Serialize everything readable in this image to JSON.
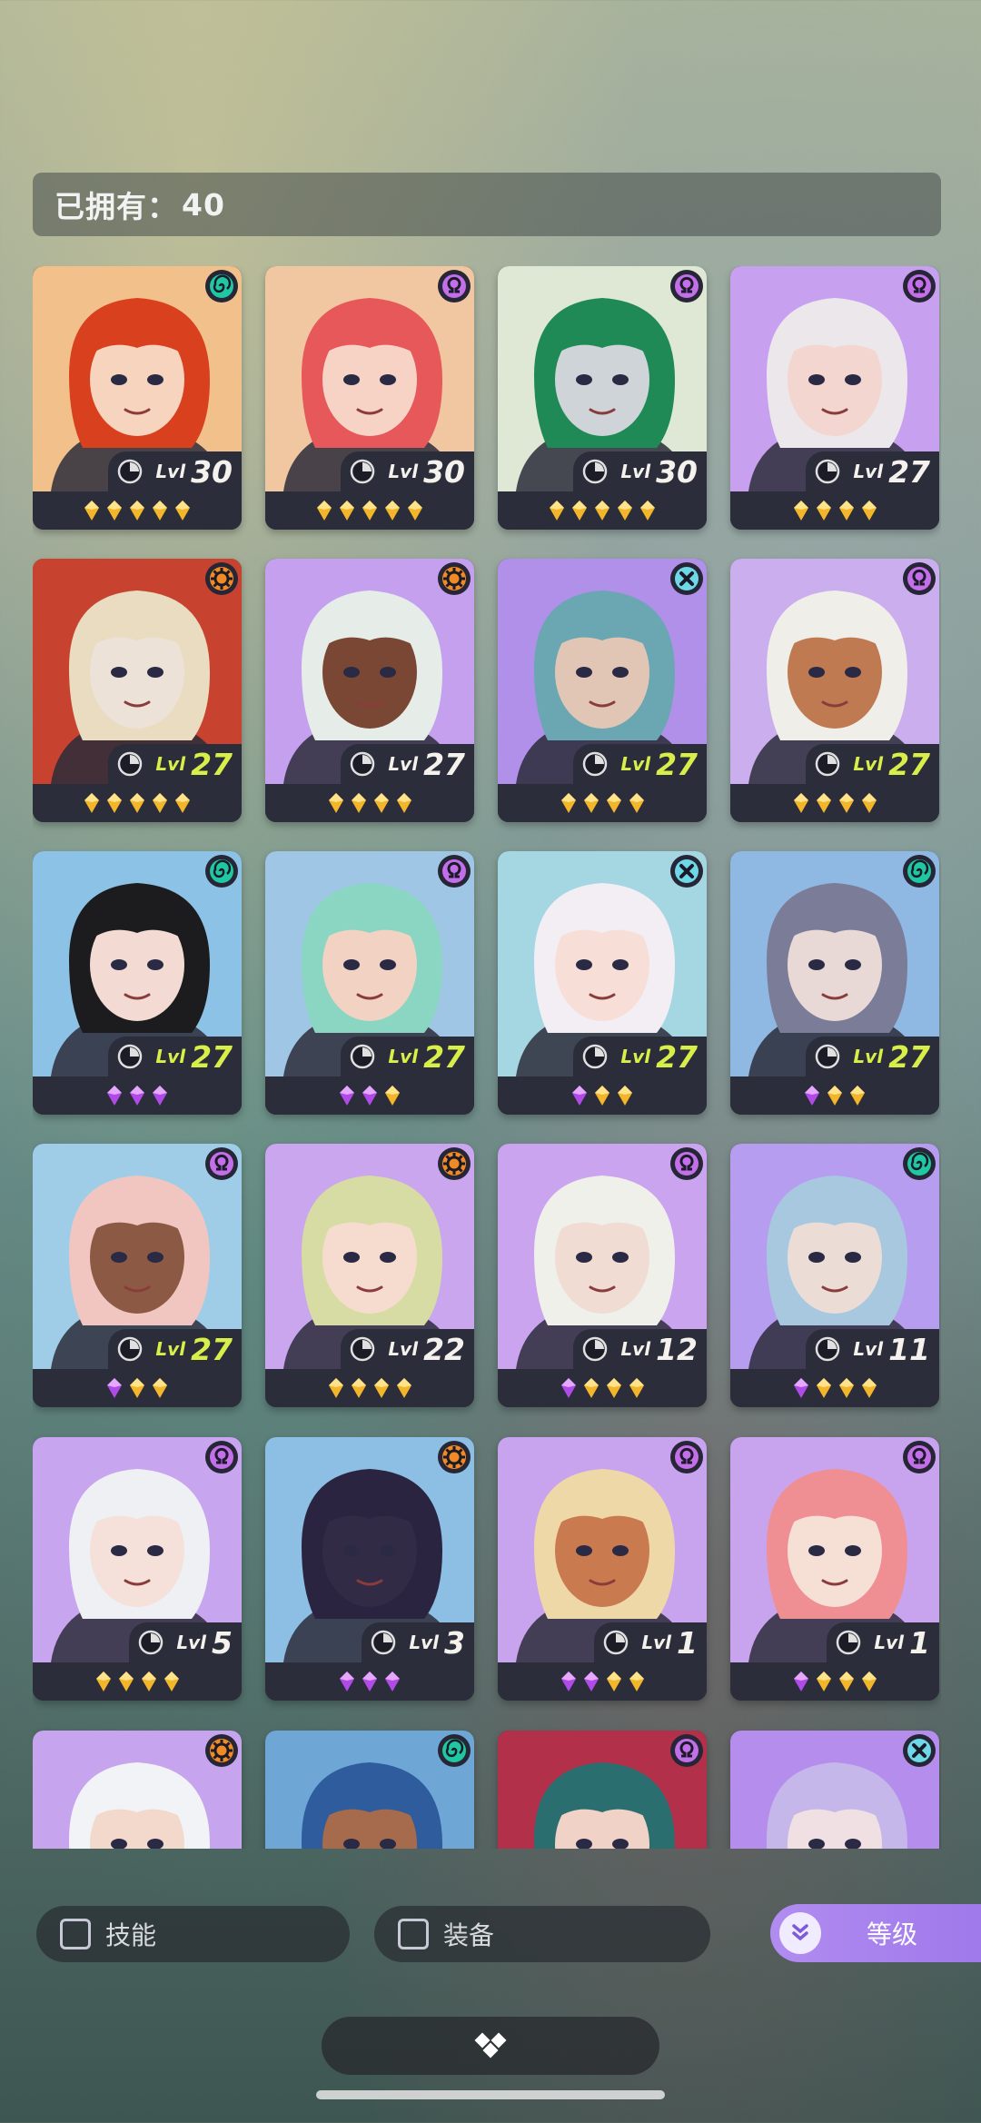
{
  "header": {
    "owned_label": "已拥有：",
    "owned_count": "40"
  },
  "colors": {
    "gold_star": "#f3b62a",
    "purple_star": "#b14be8",
    "lvl_gold": "#f5f2ee",
    "lvl_lime": "#d8ef4a"
  },
  "heroes": [
    {
      "level": "30",
      "bg": "#f2c08a",
      "hair": "#d9401e",
      "skin": "#f7d4bd",
      "class": "spiral-icon",
      "stars": [
        "gold",
        "gold",
        "gold",
        "gold",
        "gold"
      ],
      "lvl_color": "white"
    },
    {
      "level": "30",
      "bg": "#f1c7a2",
      "hair": "#e7585a",
      "skin": "#f7d3c6",
      "class": "omega-icon",
      "stars": [
        "gold",
        "gold",
        "gold",
        "gold",
        "gold"
      ],
      "lvl_color": "white"
    },
    {
      "level": "30",
      "bg": "#dfe8d4",
      "hair": "#1f8a56",
      "skin": "#cfd4d8",
      "class": "omega-icon",
      "stars": [
        "gold",
        "gold",
        "gold",
        "gold",
        "gold"
      ],
      "lvl_color": "white"
    },
    {
      "level": "27",
      "bg": "#c7a1f0",
      "hair": "#ece7ea",
      "skin": "#f2d6cf",
      "class": "omega-icon",
      "stars": [
        "gold",
        "gold",
        "gold",
        "gold"
      ],
      "lvl_color": "white"
    },
    {
      "level": "27",
      "bg": "#c8432f",
      "hair": "#eadcc0",
      "skin": "#ece2d7",
      "class": "gear-icon",
      "stars": [
        "gold",
        "gold",
        "gold",
        "gold",
        "gold"
      ],
      "lvl_color": "lime"
    },
    {
      "level": "27",
      "bg": "#c5a0ef",
      "hair": "#e6ede8",
      "skin": "#7a4735",
      "class": "gear-icon",
      "stars": [
        "gold",
        "gold",
        "gold",
        "gold"
      ],
      "lvl_color": "white"
    },
    {
      "level": "27",
      "bg": "#b190ea",
      "hair": "#6aa7b3",
      "skin": "#e2c6b5",
      "class": "cross-icon",
      "stars": [
        "gold",
        "gold",
        "gold",
        "gold"
      ],
      "lvl_color": "lime"
    },
    {
      "level": "27",
      "bg": "#caaeee",
      "hair": "#f0eee9",
      "skin": "#c07a52",
      "class": "omega-icon",
      "stars": [
        "gold",
        "gold",
        "gold",
        "gold"
      ],
      "lvl_color": "lime"
    },
    {
      "level": "27",
      "bg": "#8cc2e6",
      "hair": "#1c1c1f",
      "skin": "#f3dbd4",
      "class": "spiral-icon",
      "stars": [
        "purple",
        "purple",
        "purple"
      ],
      "lvl_color": "lime"
    },
    {
      "level": "27",
      "bg": "#9fc6e4",
      "hair": "#8bd6c2",
      "skin": "#f2d2c2",
      "class": "omega-icon",
      "stars": [
        "purple",
        "purple",
        "gold"
      ],
      "lvl_color": "lime"
    },
    {
      "level": "27",
      "bg": "#a5d7e3",
      "hair": "#f3eef4",
      "skin": "#f7dfd8",
      "class": "cross-icon",
      "stars": [
        "purple",
        "gold",
        "gold"
      ],
      "lvl_color": "lime"
    },
    {
      "level": "27",
      "bg": "#8fb8e2",
      "hair": "#7a7c98",
      "skin": "#e8d9d6",
      "class": "spiral-icon",
      "stars": [
        "purple",
        "gold",
        "gold"
      ],
      "lvl_color": "lime"
    },
    {
      "level": "27",
      "bg": "#9fcde8",
      "hair": "#f2c6c0",
      "skin": "#8c5a44",
      "class": "omega-icon",
      "stars": [
        "purple",
        "gold",
        "gold"
      ],
      "lvl_color": "lime"
    },
    {
      "level": "22",
      "bg": "#c9a6ee",
      "hair": "#d6dca3",
      "skin": "#f6dccf",
      "class": "gear-icon",
      "stars": [
        "gold",
        "gold",
        "gold",
        "gold"
      ],
      "lvl_color": "white"
    },
    {
      "level": "12",
      "bg": "#caa4ee",
      "hair": "#eef0e9",
      "skin": "#f0dcd3",
      "class": "omega-icon",
      "stars": [
        "purple",
        "gold",
        "gold",
        "gold"
      ],
      "lvl_color": "white"
    },
    {
      "level": "11",
      "bg": "#b79df0",
      "hair": "#a8c8df",
      "skin": "#ecdcd6",
      "class": "spiral-icon",
      "stars": [
        "purple",
        "gold",
        "gold",
        "gold"
      ],
      "lvl_color": "white"
    },
    {
      "level": "5",
      "bg": "#c8a5ef",
      "hair": "#eff0f4",
      "skin": "#f5e0da",
      "class": "omega-icon",
      "stars": [
        "gold",
        "gold",
        "gold",
        "gold"
      ],
      "lvl_color": "white"
    },
    {
      "level": "3",
      "bg": "#8dbfe5",
      "hair": "#2b2440",
      "skin": "#322b45",
      "class": "gear-icon",
      "stars": [
        "purple",
        "purple",
        "purple"
      ],
      "lvl_color": "white"
    },
    {
      "level": "1",
      "bg": "#c8a3ee",
      "hair": "#efd8a8",
      "skin": "#c97a4e",
      "class": "omega-icon",
      "stars": [
        "purple",
        "purple",
        "gold",
        "gold"
      ],
      "lvl_color": "white"
    },
    {
      "level": "1",
      "bg": "#c9a4ee",
      "hair": "#ef8f93",
      "skin": "#f6dfd5",
      "class": "omega-icon",
      "stars": [
        "purple",
        "gold",
        "gold",
        "gold"
      ],
      "lvl_color": "white"
    },
    {
      "level": "",
      "bg": "#c7a5ee",
      "hair": "#f2f3f6",
      "skin": "#f3d9cc",
      "class": "gear-icon",
      "stars": [],
      "lvl_color": "white"
    },
    {
      "level": "",
      "bg": "#6ea6d6",
      "hair": "#2f5c9d",
      "skin": "#a66a4c",
      "class": "spiral-icon",
      "stars": [],
      "lvl_color": "white"
    },
    {
      "level": "",
      "bg": "#b3304a",
      "hair": "#2a6e70",
      "skin": "#f0d2c6",
      "class": "omega-icon",
      "stars": [],
      "lvl_color": "white"
    },
    {
      "level": "",
      "bg": "#b48ded",
      "hair": "#c5b7e9",
      "skin": "#f0e0e3",
      "class": "cross-icon",
      "stars": [],
      "lvl_color": "white"
    }
  ],
  "lvl_prefix": "Lvl",
  "filters": {
    "skill_label": "技能",
    "equip_label": "装备",
    "sort_label": "等级"
  }
}
